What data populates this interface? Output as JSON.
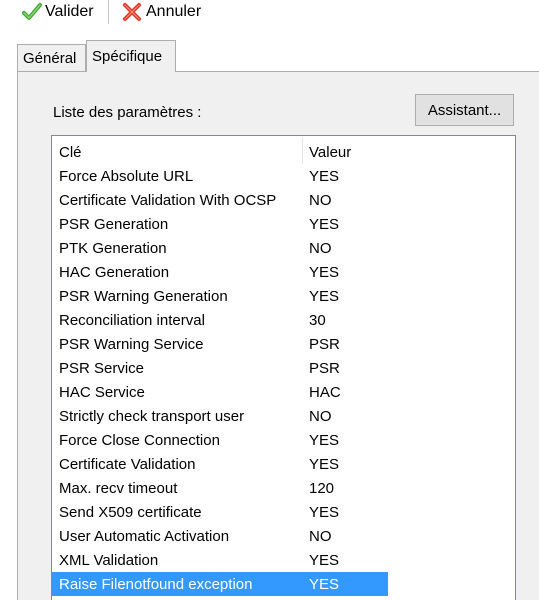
{
  "toolbar": {
    "validate_label": "Valider",
    "cancel_label": "Annuler",
    "validate_icon": "check-icon",
    "cancel_icon": "cross-icon",
    "validate_color": "#3aa635",
    "cancel_color": "#e2372a"
  },
  "tabs": [
    {
      "label": "Général",
      "active": false
    },
    {
      "label": "Spécifique",
      "active": true
    }
  ],
  "panel": {
    "params_label": "Liste des paramètres :",
    "assistant_label": "Assistant..."
  },
  "list": {
    "headers": {
      "key": "Clé",
      "value": "Valeur"
    },
    "selected_color": "#3399ff",
    "rows": [
      {
        "key": "Force Absolute URL",
        "value": "YES"
      },
      {
        "key": "Certificate Validation With OCSP",
        "value": "NO"
      },
      {
        "key": "PSR Generation",
        "value": "YES"
      },
      {
        "key": "PTK Generation",
        "value": "NO"
      },
      {
        "key": "HAC Generation",
        "value": "YES"
      },
      {
        "key": "PSR Warning Generation",
        "value": "YES"
      },
      {
        "key": "Reconciliation interval",
        "value": "30"
      },
      {
        "key": "PSR Warning Service",
        "value": "PSR"
      },
      {
        "key": "PSR Service",
        "value": "PSR"
      },
      {
        "key": "HAC Service",
        "value": "HAC"
      },
      {
        "key": "Strictly check transport user",
        "value": "NO"
      },
      {
        "key": "Force Close Connection",
        "value": "YES"
      },
      {
        "key": "Certificate Validation",
        "value": "YES"
      },
      {
        "key": "Max. recv timeout",
        "value": "120"
      },
      {
        "key": "Send X509 certificate",
        "value": "YES"
      },
      {
        "key": "User Automatic Activation",
        "value": "NO"
      },
      {
        "key": "XML Validation",
        "value": "YES"
      },
      {
        "key": "Raise Filenotfound exception",
        "value": "YES",
        "selected": true
      }
    ]
  }
}
